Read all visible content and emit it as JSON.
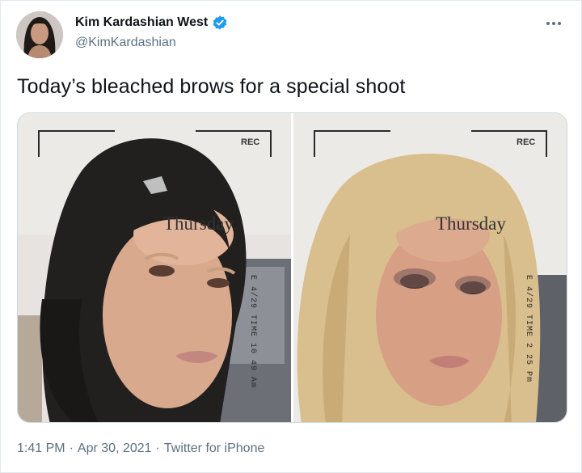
{
  "author": {
    "display_name": "Kim Kardashian West",
    "handle": "@KimKardashian",
    "verified": true
  },
  "tweet": {
    "text": "Today’s bleached brows for a special shoot"
  },
  "media": {
    "photos": [
      {
        "rec": "REC",
        "day": "Thursday",
        "stamp": "E 4/29 TIME 10 49 Am"
      },
      {
        "rec": "REC",
        "day": "Thursday",
        "stamp": "E 4/29 TIME 2 25 Pm"
      }
    ]
  },
  "meta": {
    "time": "1:41 PM",
    "sep1": "·",
    "date": "Apr 30, 2021",
    "sep2": "·",
    "source": "Twitter for iPhone"
  },
  "icons": {
    "verified": "verified-badge-icon",
    "more": "more-options-icon"
  },
  "colors": {
    "verified": "#1d9bf0",
    "secondary_text": "#5b7083"
  }
}
